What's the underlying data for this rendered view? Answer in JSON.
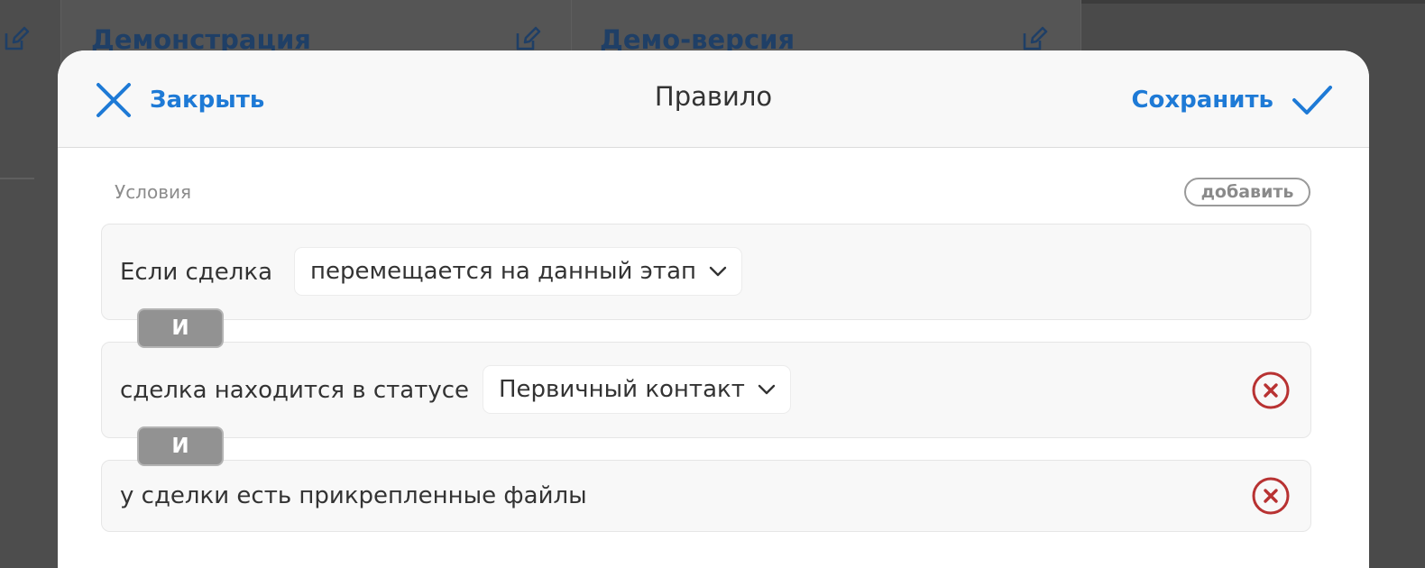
{
  "background": {
    "columns": [
      {
        "title": "Демонстрация"
      },
      {
        "title": "Демо-версия"
      }
    ]
  },
  "modal": {
    "title": "Правило",
    "close_label": "Закрыть",
    "save_label": "Сохранить",
    "section_label": "Условия",
    "add_label": "добавить",
    "connector_label": "И",
    "conditions": [
      {
        "text": "Если сделка",
        "select_value": "перемещается на данный этап",
        "removable": false
      },
      {
        "text": "сделка находится в статусе",
        "select_value": "Первичный контакт",
        "removable": true
      },
      {
        "text": "у сделки есть прикрепленные файлы",
        "removable": true
      }
    ]
  },
  "icons": {
    "close": "close-x-icon",
    "save": "checkmark-icon",
    "dropdown": "chevron-down-icon",
    "remove": "remove-circle-x-icon",
    "edit": "edit-pencil-icon"
  },
  "colors": {
    "accent": "#1e7ad6",
    "danger": "#b83232",
    "badge": "#929292",
    "overlay": "#4a4a4a"
  }
}
